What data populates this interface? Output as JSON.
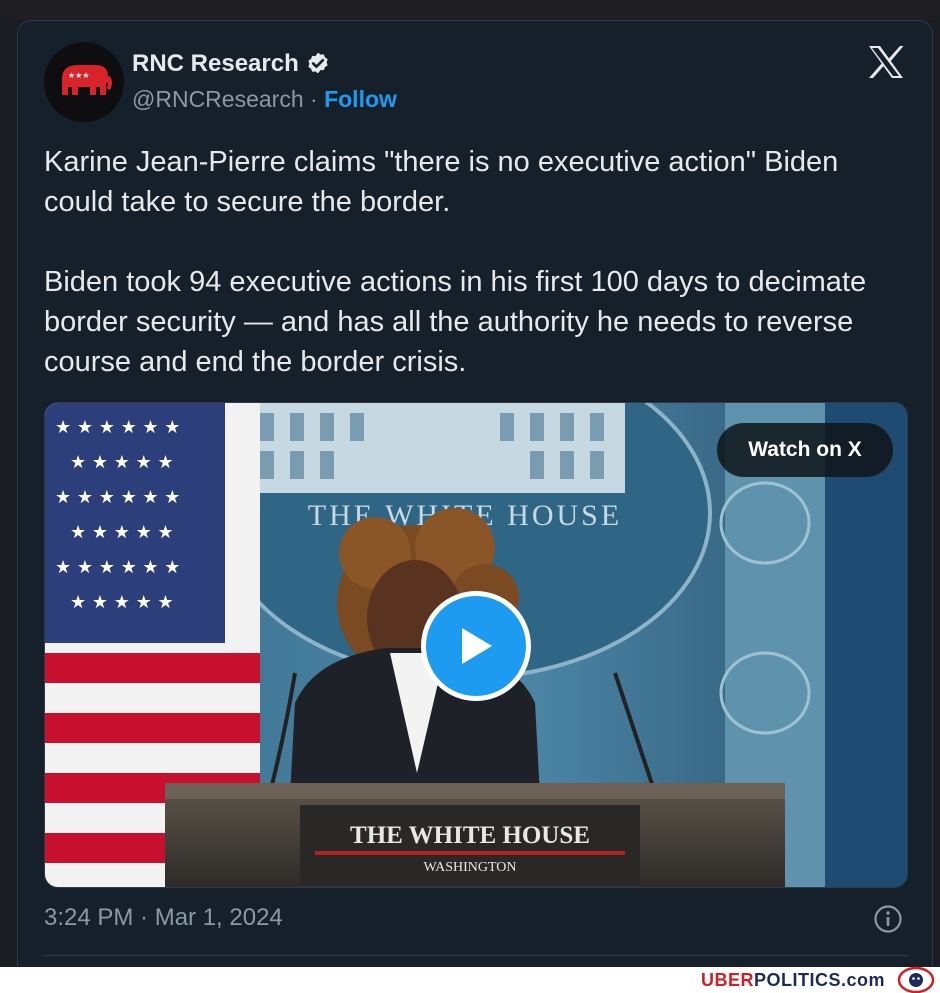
{
  "tweet": {
    "author_name": "RNC Research",
    "handle": "@RNCResearch",
    "separator": "·",
    "follow_label": "Follow",
    "text": "Karine Jean-Pierre claims \"there is no executive action\" Biden could take to secure the border.\n\nBiden took 94 executive actions in his first 100 days to decimate border security — and has all the authority he needs to reverse course and end the border crisis.",
    "timestamp": "3:24 PM · Mar 1, 2024"
  },
  "media": {
    "watch_label": "Watch on X",
    "seal_text": "THE WHITE HOUSE",
    "podium_title": "THE WHITE HOUSE",
    "podium_subtitle": "WASHINGTON"
  },
  "footer": {
    "brand_red": "UBER",
    "brand_blue": "POLITICS.com"
  },
  "icons": {
    "avatar": "republican-elephant-icon",
    "verified": "verified-badge-icon",
    "close": "x-logo-icon",
    "play": "play-icon",
    "info": "info-icon"
  },
  "colors": {
    "card_background": "#15202b",
    "link_blue": "#1d9bf0",
    "text_primary": "#e7e9ea",
    "text_secondary": "#8b98a5",
    "rnc_red": "#d8232a"
  }
}
